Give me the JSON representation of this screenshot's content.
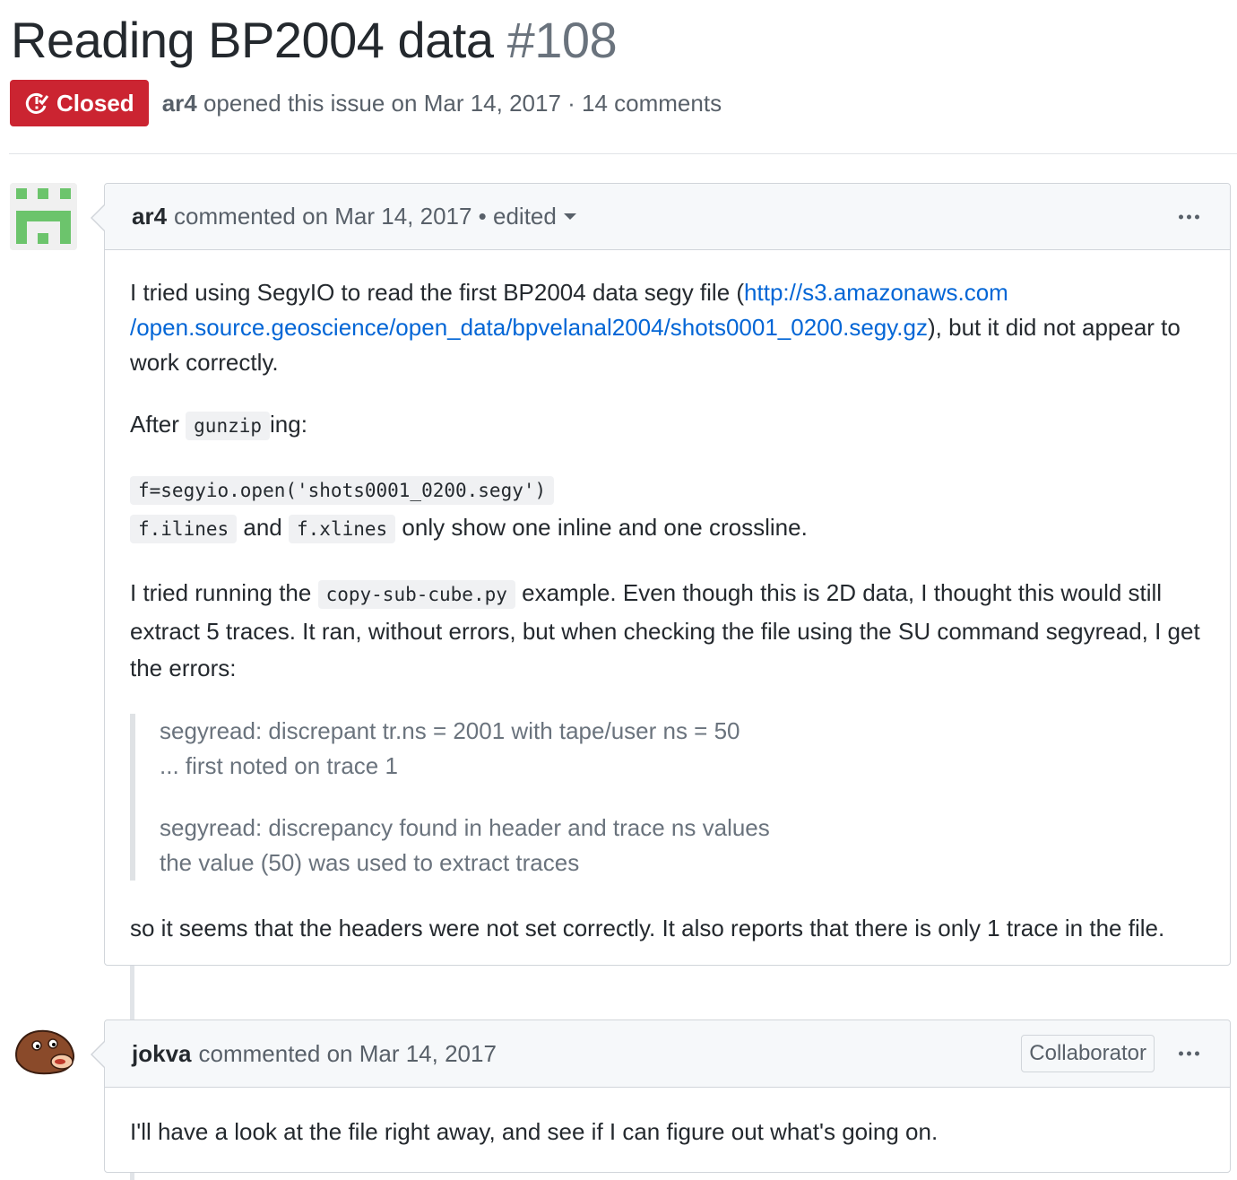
{
  "issue": {
    "title": "Reading BP2004 data",
    "number": "#108",
    "state": "Closed",
    "author": "ar4",
    "meta": "opened this issue on Mar 14, 2017 · 14 comments"
  },
  "comments": [
    {
      "author": "ar4",
      "action": "commented on Mar 14, 2017 • edited",
      "body": {
        "p1_before": "I tried using SegyIO to read the first BP2004 data segy file (",
        "p1_link_line1": "http://s3.amazonaws.com",
        "p1_link_line2": "/open.source.geoscience/open_data/bpvelanal2004/shots0001_0200.segy.gz",
        "p1_after": "), but it did not appear to work correctly.",
        "p2_before": "After",
        "p2_code": "gunzip",
        "p2_after": "ing:",
        "p3_code_open": "f=segyio.open('shots0001_0200.segy')",
        "p3_code_ilines": "f.ilines",
        "p3_and": "and",
        "p3_code_xlines": "f.xlines",
        "p3_after": "only show one inline and one crossline.",
        "p4_before": "I tried running the",
        "p4_code": "copy-sub-cube.py",
        "p4_after": "example. Even though this is 2D data, I thought this would still extract 5 traces. It ran, without errors, but when checking the file using the SU command segyread, I get the errors:",
        "quote_1a": "segyread: discrepant tr.ns = 2001 with tape/user ns = 50",
        "quote_1b": "... first noted on trace 1",
        "quote_2a": "segyread: discrepancy found in header and trace ns values",
        "quote_2b": "the value (50) was used to extract traces",
        "p5": "so it seems that the headers were not set correctly. It also reports that there is only 1 trace in the file."
      }
    },
    {
      "author": "jokva",
      "action": "commented on Mar 14, 2017",
      "role": "Collaborator",
      "body": {
        "p1": "I'll have a look at the file right away, and see if I can figure out what's going on."
      }
    }
  ],
  "colors": {
    "closed": "#cb2431",
    "link": "#0366d6",
    "identicon": "#6cc46c"
  }
}
